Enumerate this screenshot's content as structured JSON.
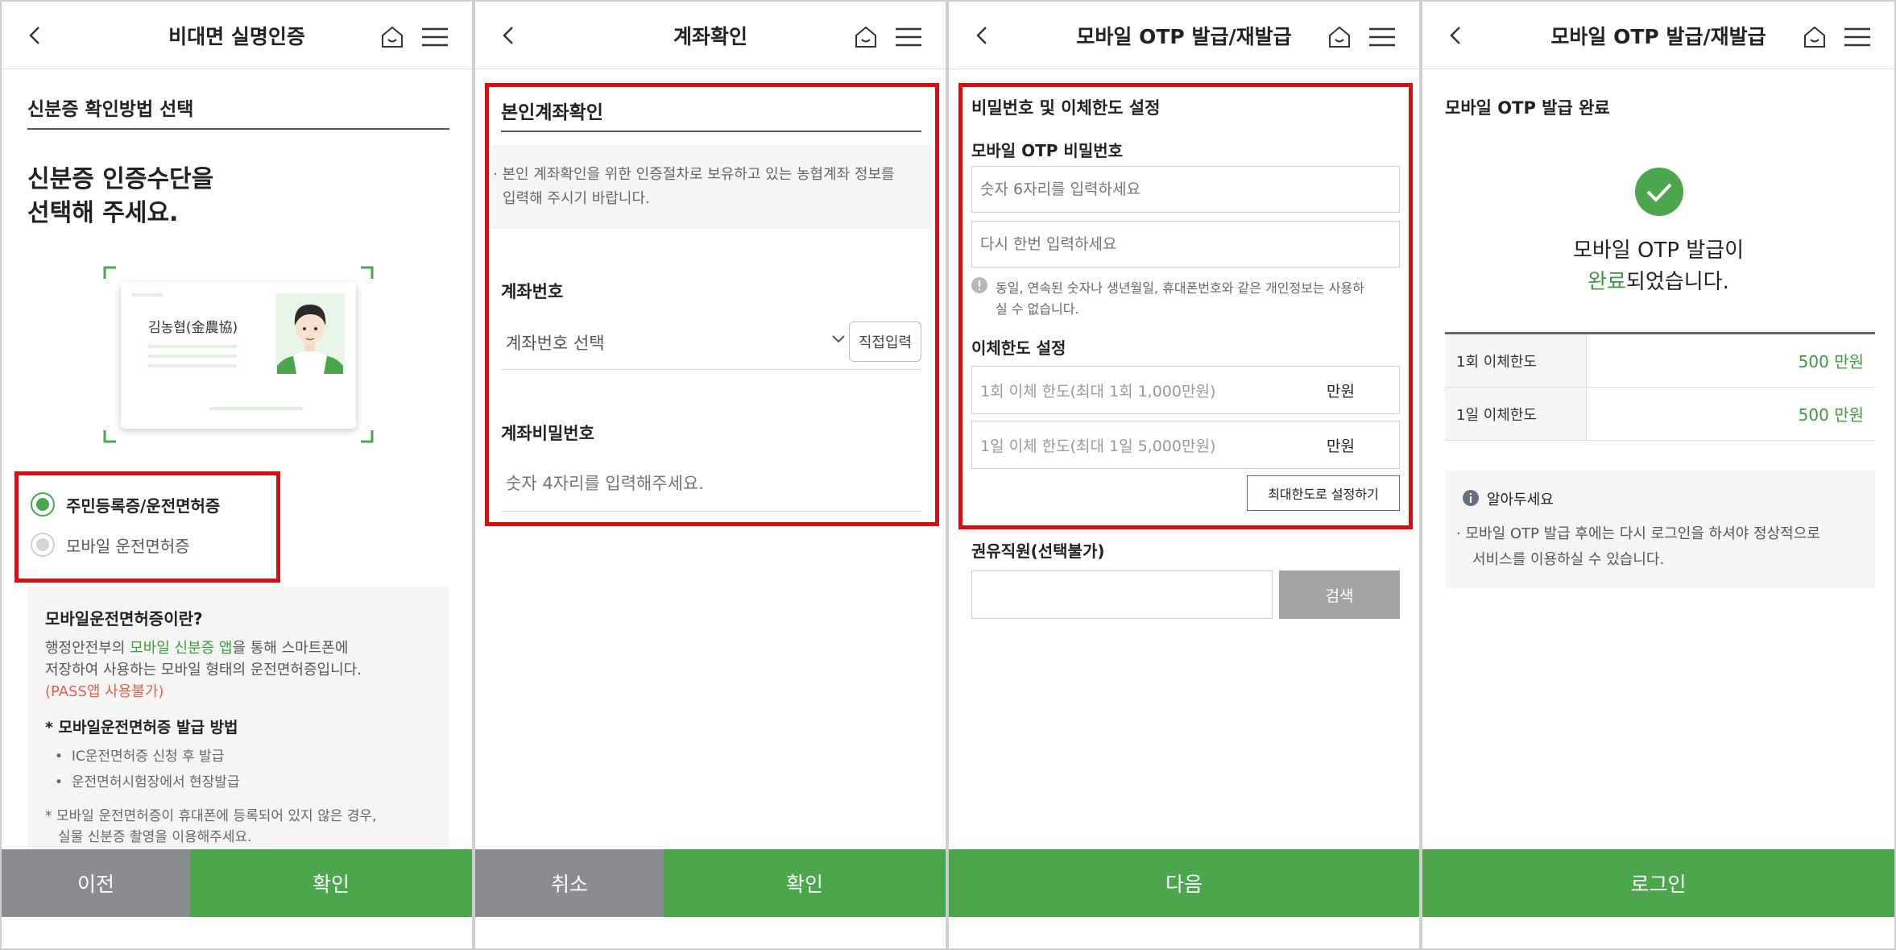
{
  "panel1": {
    "title": "비대면 실명인증",
    "section_title": "신분증 확인방법 선택",
    "heading_line1": "신분증 인증수단을",
    "heading_line2": "선택해 주세요.",
    "card_name": "김농협(金農協)",
    "options": [
      {
        "label": "주민등록증/운전면허증",
        "selected": true
      },
      {
        "label": "모바일 운전면허증",
        "selected": false
      }
    ],
    "info_title": "모바일운전면허증이란?",
    "info_line1_pre": "행정안전부의 ",
    "info_line1_link": "모바일 신분증 앱",
    "info_line1_post": "을 통해 스마트폰에",
    "info_line2": "저장하여 사용하는 모바일 형태의 운전면허증입니다.",
    "info_warning": "(PASS앱 사용불가)",
    "method_title": "* 모바일운전면허증 발급 방법",
    "method_items": [
      "IC운전면허증 신청 후 발급",
      "운전면허시험장에서 현장발급"
    ],
    "note_line1": "*  모바일 운전면허증이 휴대폰에 등록되어 있지 않은 경우,",
    "note_line2": "실물 신분증 촬영을 이용해주세요.",
    "btn_prev": "이전",
    "btn_confirm": "확인"
  },
  "panel2": {
    "title": "계좌확인",
    "section_title": "본인계좌확인",
    "notice_line1": "· 본인 계좌확인을 위한 인증절차로 보유하고 있는 농협계좌 정보를",
    "notice_line2": "입력해 주시기 바랍니다.",
    "account_label": "계좌번호",
    "account_select": "계좌번호 선택",
    "direct_input": "직접입력",
    "password_label": "계좌비밀번호",
    "password_placeholder": "숫자 4자리를 입력해주세요.",
    "btn_cancel": "취소",
    "btn_confirm": "확인"
  },
  "panel3": {
    "title": "모바일 OTP 발급/재발급",
    "section_title": "비밀번호 및 이체한도 설정",
    "otp_pw_label": "모바일 OTP 비밀번호",
    "pw_placeholder": "숫자 6자리를 입력하세요",
    "pw_confirm_placeholder": "다시 한번 입력하세요",
    "pw_notice_line1": "동일, 연속된 숫자나 생년월일, 휴대폰번호와 같은 개인정보는 사용하",
    "pw_notice_line2": "실 수 없습니다.",
    "limit_label": "이체한도 설정",
    "once_placeholder": "1회 이체 한도(최대 1회 1,000만원)",
    "daily_placeholder": "1일 이체 한도(최대 1일 5,000만원)",
    "unit": "만원",
    "max_button": "최대한도로 설정하기",
    "staff_label": "권유직원(선택불가)",
    "search_button": "검색",
    "btn_next": "다음"
  },
  "panel4": {
    "title": "모바일 OTP 발급/재발급",
    "section_title": "모바일 OTP 발급 완료",
    "msg_line1": "모바일 OTP 발급이",
    "msg_highlight": "완료",
    "msg_line2_rest": "되었습니다.",
    "rows": [
      {
        "label": "1회 이체한도",
        "value": "500 만원"
      },
      {
        "label": "1일 이체한도",
        "value": "500 만원"
      }
    ],
    "notice_title": "알아두세요",
    "notice_line1": "· 모바일 OTP 발급 후에는 다시 로그인을 하셔야 정상적으로",
    "notice_line2": "서비스를 이용하실 수 있습니다.",
    "btn_login": "로그인"
  },
  "colors": {
    "green": "#4ba64d",
    "gray": "#8a8c91",
    "red_highlight": "#d50f14",
    "warning": "#e0614f"
  }
}
